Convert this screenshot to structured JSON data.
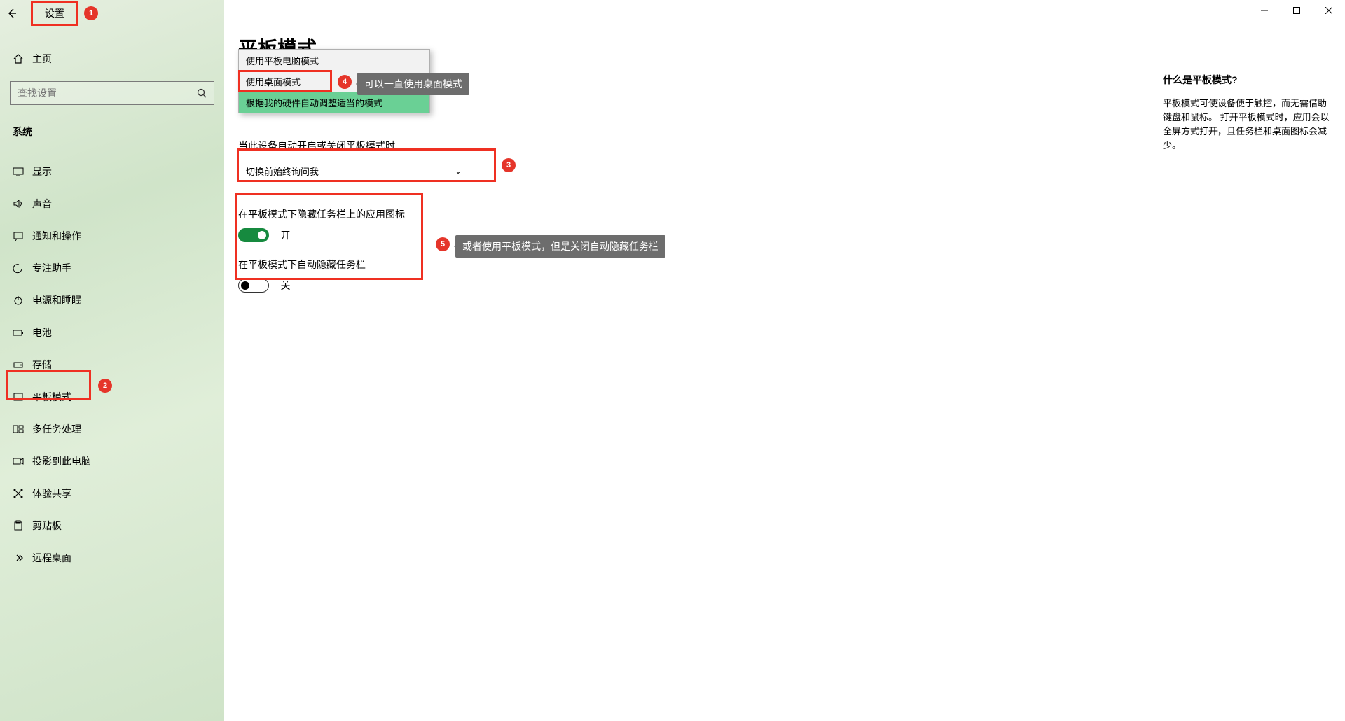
{
  "window": {
    "title": "设置"
  },
  "sidebar": {
    "home": "主页",
    "search_placeholder": "查找设置",
    "section": "系统",
    "items": [
      {
        "label": "显示"
      },
      {
        "label": "声音"
      },
      {
        "label": "通知和操作"
      },
      {
        "label": "专注助手"
      },
      {
        "label": "电源和睡眠"
      },
      {
        "label": "电池"
      },
      {
        "label": "存储"
      },
      {
        "label": "平板模式"
      },
      {
        "label": "多任务处理"
      },
      {
        "label": "投影到此电脑"
      },
      {
        "label": "体验共享"
      },
      {
        "label": "剪贴板"
      },
      {
        "label": "远程桌面"
      }
    ]
  },
  "main": {
    "title": "平板模式",
    "dropdown": {
      "opt1": "使用平板电脑模式",
      "opt2": "使用桌面模式",
      "opt3": "根据我的硬件自动调整适当的模式"
    },
    "auto_label": "当此设备自动开启或关闭平板模式时",
    "auto_value": "切换前始终询问我",
    "hide_icons_label": "在平板模式下隐藏任务栏上的应用图标",
    "on": "开",
    "autohide_label": "在平板模式下自动隐藏任务栏",
    "off": "关"
  },
  "info": {
    "heading": "什么是平板模式?",
    "body": "平板模式可使设备便于触控，而无需借助键盘和鼠标。 打开平板模式时，应用会以全屏方式打开，且任务栏和桌面图标会减少。"
  },
  "annotations": {
    "tip4": "可以一直使用桌面模式",
    "tip5": "或者使用平板模式，但是关闭自动隐藏任务栏"
  }
}
